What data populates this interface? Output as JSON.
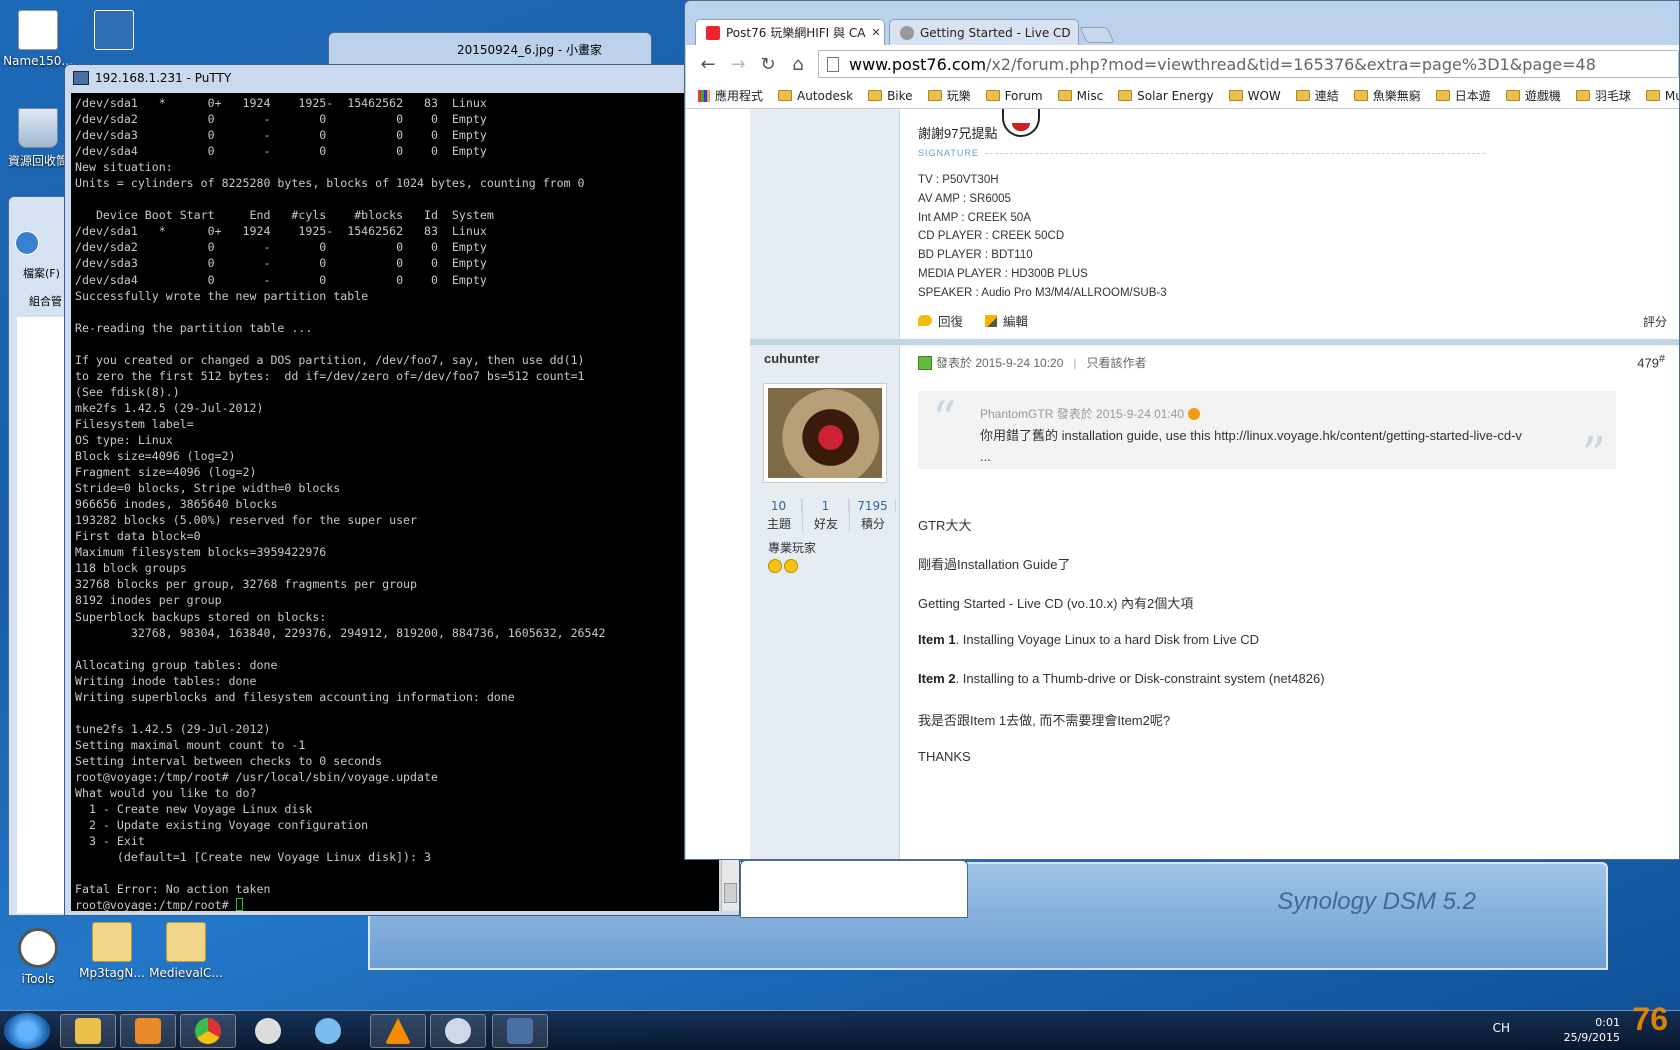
{
  "desktop": {
    "icons": [
      {
        "label": "Name150..."
      },
      {
        "label": "iTools"
      },
      {
        "label": "Mp3tagN..."
      },
      {
        "label": "MedievalC..."
      }
    ],
    "recycle_label": "資源回收筒"
  },
  "explorer": {
    "menu": "檔案(F)",
    "organize": "組合管"
  },
  "imageviewer": {
    "title": "20150924_6.jpg - 小畫家"
  },
  "putty": {
    "title": "192.168.1.231 - PuTTY",
    "terminal": "/dev/sda1   *      0+   1924    1925-  15462562   83  Linux\n/dev/sda2          0       -       0          0    0  Empty\n/dev/sda3          0       -       0          0    0  Empty\n/dev/sda4          0       -       0          0    0  Empty\nNew situation:\nUnits = cylinders of 8225280 bytes, blocks of 1024 bytes, counting from 0\n\n   Device Boot Start     End   #cyls    #blocks   Id  System\n/dev/sda1   *      0+   1924    1925-  15462562   83  Linux\n/dev/sda2          0       -       0          0    0  Empty\n/dev/sda3          0       -       0          0    0  Empty\n/dev/sda4          0       -       0          0    0  Empty\nSuccessfully wrote the new partition table\n\nRe-reading the partition table ...\n\nIf you created or changed a DOS partition, /dev/foo7, say, then use dd(1)\nto zero the first 512 bytes:  dd if=/dev/zero of=/dev/foo7 bs=512 count=1\n(See fdisk(8).)\nmke2fs 1.42.5 (29-Jul-2012)\nFilesystem label=\nOS type: Linux\nBlock size=4096 (log=2)\nFragment size=4096 (log=2)\nStride=0 blocks, Stripe width=0 blocks\n966656 inodes, 3865640 blocks\n193282 blocks (5.00%) reserved for the super user\nFirst data block=0\nMaximum filesystem blocks=3959422976\n118 block groups\n32768 blocks per group, 32768 fragments per group\n8192 inodes per group\nSuperblock backups stored on blocks:\n        32768, 98304, 163840, 229376, 294912, 819200, 884736, 1605632, 26542\n\nAllocating group tables: done\nWriting inode tables: done\nWriting superblocks and filesystem accounting information: done\n\ntune2fs 1.42.5 (29-Jul-2012)\nSetting maximal mount count to -1\nSetting interval between checks to 0 seconds\nroot@voyage:/tmp/root# /usr/local/sbin/voyage.update\nWhat would you like to do?\n  1 - Create new Voyage Linux disk\n  2 - Update existing Voyage configuration\n  3 - Exit\n      (default=1 [Create new Voyage Linux disk]): 3\n\nFatal Error: No action taken\nroot@voyage:/tmp/root# "
  },
  "chrome": {
    "tabs": [
      {
        "label": "Post76 玩樂網HIFI 與 CA"
      },
      {
        "label": "Getting Started - Live CD"
      }
    ],
    "url_domain": "www.post76.com",
    "url_path": "/x2/forum.php?mod=viewthread&tid=165376&extra=page%3D1&page=48",
    "bookmarks": [
      "應用程式",
      "Autodesk",
      "Bike",
      "玩樂",
      "Forum",
      "Misc",
      "Solar Energy",
      "WOW",
      "連結",
      "魚樂無窮",
      "日本遊",
      "遊戲機",
      "羽毛球",
      "Music"
    ]
  },
  "prev_post": {
    "text": "謝謝97兄提點",
    "signature_label": "SIGNATURE",
    "signature_lines": [
      "TV : P50VT30H",
      "AV AMP : SR6005",
      "Int AMP : CREEK 50A",
      "CD PLAYER : CREEK 50CD",
      "BD PLAYER : BDT110",
      "MEDIA PLAYER : HD300B PLUS",
      "SPEAKER : Audio Pro M3/M4/ALLROOM/SUB-3"
    ],
    "reply": "回復",
    "edit": "編輯",
    "rate": "評分"
  },
  "post": {
    "author": "cuhunter",
    "stats": [
      {
        "value": "10",
        "label": "主題"
      },
      {
        "value": "1",
        "label": "好友"
      },
      {
        "value": "7195",
        "label": "積分"
      }
    ],
    "rank": "專業玩家",
    "posted": "發表於 2015-9-24 10:20",
    "only_author": "只看該作者",
    "floor": "479",
    "floor_suffix": "#",
    "quote_header": "PhantomGTR 發表於 2015-9-24 01:40",
    "quote_text": "你用錯了舊的 installation guide, use this http://linux.voyage.hk/content/getting-started-live-cd-v",
    "quote_more": "...",
    "lines": {
      "l1": "GTR大大",
      "l2": "剛看過Installation Guide了",
      "l3": "Getting Started - Live CD (vo.10.x) 內有2個大項",
      "l4_bold": "Item 1",
      "l4": ". Installing Voyage Linux to a hard Disk from Live CD",
      "l5_bold": "Item 2",
      "l5": ". Installing to a Thumb-drive or Disk-constraint system (net4826)",
      "l6": "我是否跟Item 1去做, 而不需要理會Item2呢?",
      "l7": "THANKS"
    }
  },
  "background": {
    "synology": "Synology DSM 5.2"
  },
  "taskbar": {
    "tray": "CH",
    "time": "0:01",
    "date": "25/9/2015",
    "watermark": "76"
  }
}
